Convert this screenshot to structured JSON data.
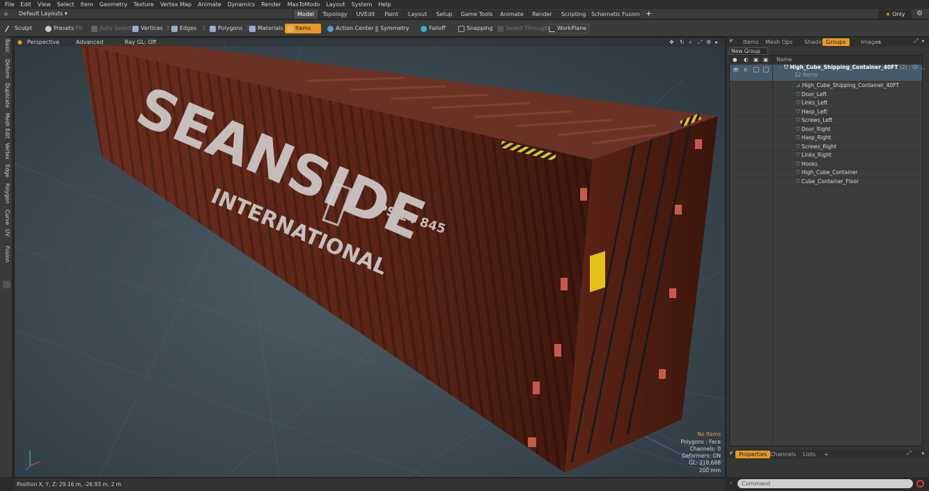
{
  "menu": [
    "File",
    "Edit",
    "View",
    "Select",
    "Item",
    "Geometry",
    "Texture",
    "Vertex Map",
    "Animate",
    "Dynamics",
    "Render",
    "MaxToModo",
    "Layout",
    "System",
    "Help"
  ],
  "layouts": {
    "default_label": "Default Layouts",
    "tabs": [
      "Model",
      "Topology",
      "UVEdit",
      "Paint",
      "Layout",
      "Setup",
      "Game Tools",
      "Animate",
      "Render",
      "Scripting",
      "Schematic Fusion"
    ],
    "add": "+",
    "only_label": "Only",
    "only_star": "★"
  },
  "toolbar": {
    "sculpt": "Sculpt",
    "presets": "Presets",
    "presets_key": "F6",
    "auto_select": "Auto Select",
    "vertices": "Vertices",
    "vertices_key": "1",
    "edges": "Edges",
    "edges_key": "2",
    "polygons": "Polygons",
    "polygons_key": "3",
    "materials": "Materials",
    "items": "Items",
    "action_center": "Action Center",
    "symmetry": "Symmetry",
    "falloff": "Falloff",
    "snapping": "Snapping",
    "select_through": "Select Through",
    "workplane": "WorkPlane"
  },
  "left_tabs": [
    "Basic",
    "Deform",
    "Duplicate",
    "Mesh Edit",
    "Vertex",
    "Edge",
    "Polygon",
    "Curve",
    "UV",
    "Fusion"
  ],
  "viewport": {
    "view": "Perspective",
    "shading": "Advanced",
    "raygl": "Ray GL: Off",
    "container_text1": "SEANSIDE",
    "container_text2": "INTERNATIONAL",
    "container_code": "PS 24 845",
    "info": {
      "items": "No Items",
      "polygons": "Polygons : Face",
      "channels": "Channels: 0",
      "deformers": "Deformers: ON",
      "gl": "GL: 318,688",
      "size": "200 mm"
    }
  },
  "status": "Position X, Y, Z:  29.16 m, -26.93 m, 2 m",
  "right_panel": {
    "tabs": [
      "Items",
      "Mesh Ops",
      "Shading",
      "Groups",
      "Images"
    ],
    "active_tab": "Groups",
    "add": "+",
    "new_group": "New Group",
    "name_header": "Name",
    "root": "High_Cube_Shipping_Container_40FT",
    "root_suffix": "(2) : Gr ...",
    "root_count": "12 Items",
    "children": [
      "High_Cube_Shipping_Container_40FT",
      "Door_Left",
      "Links_Left",
      "Hasp_Left",
      "Screws_Left",
      "Door_Right",
      "Hasp_Right",
      "Screws_Right",
      "Links_Right",
      "Hooks",
      "High_Cube_Container",
      "Cube_Container_Floor"
    ],
    "bottom_tabs": [
      "Properties",
      "Channels",
      "Lists"
    ],
    "command_placeholder": "Command"
  },
  "colors": {
    "accent": "#e79a27",
    "container": "#5a2417"
  }
}
